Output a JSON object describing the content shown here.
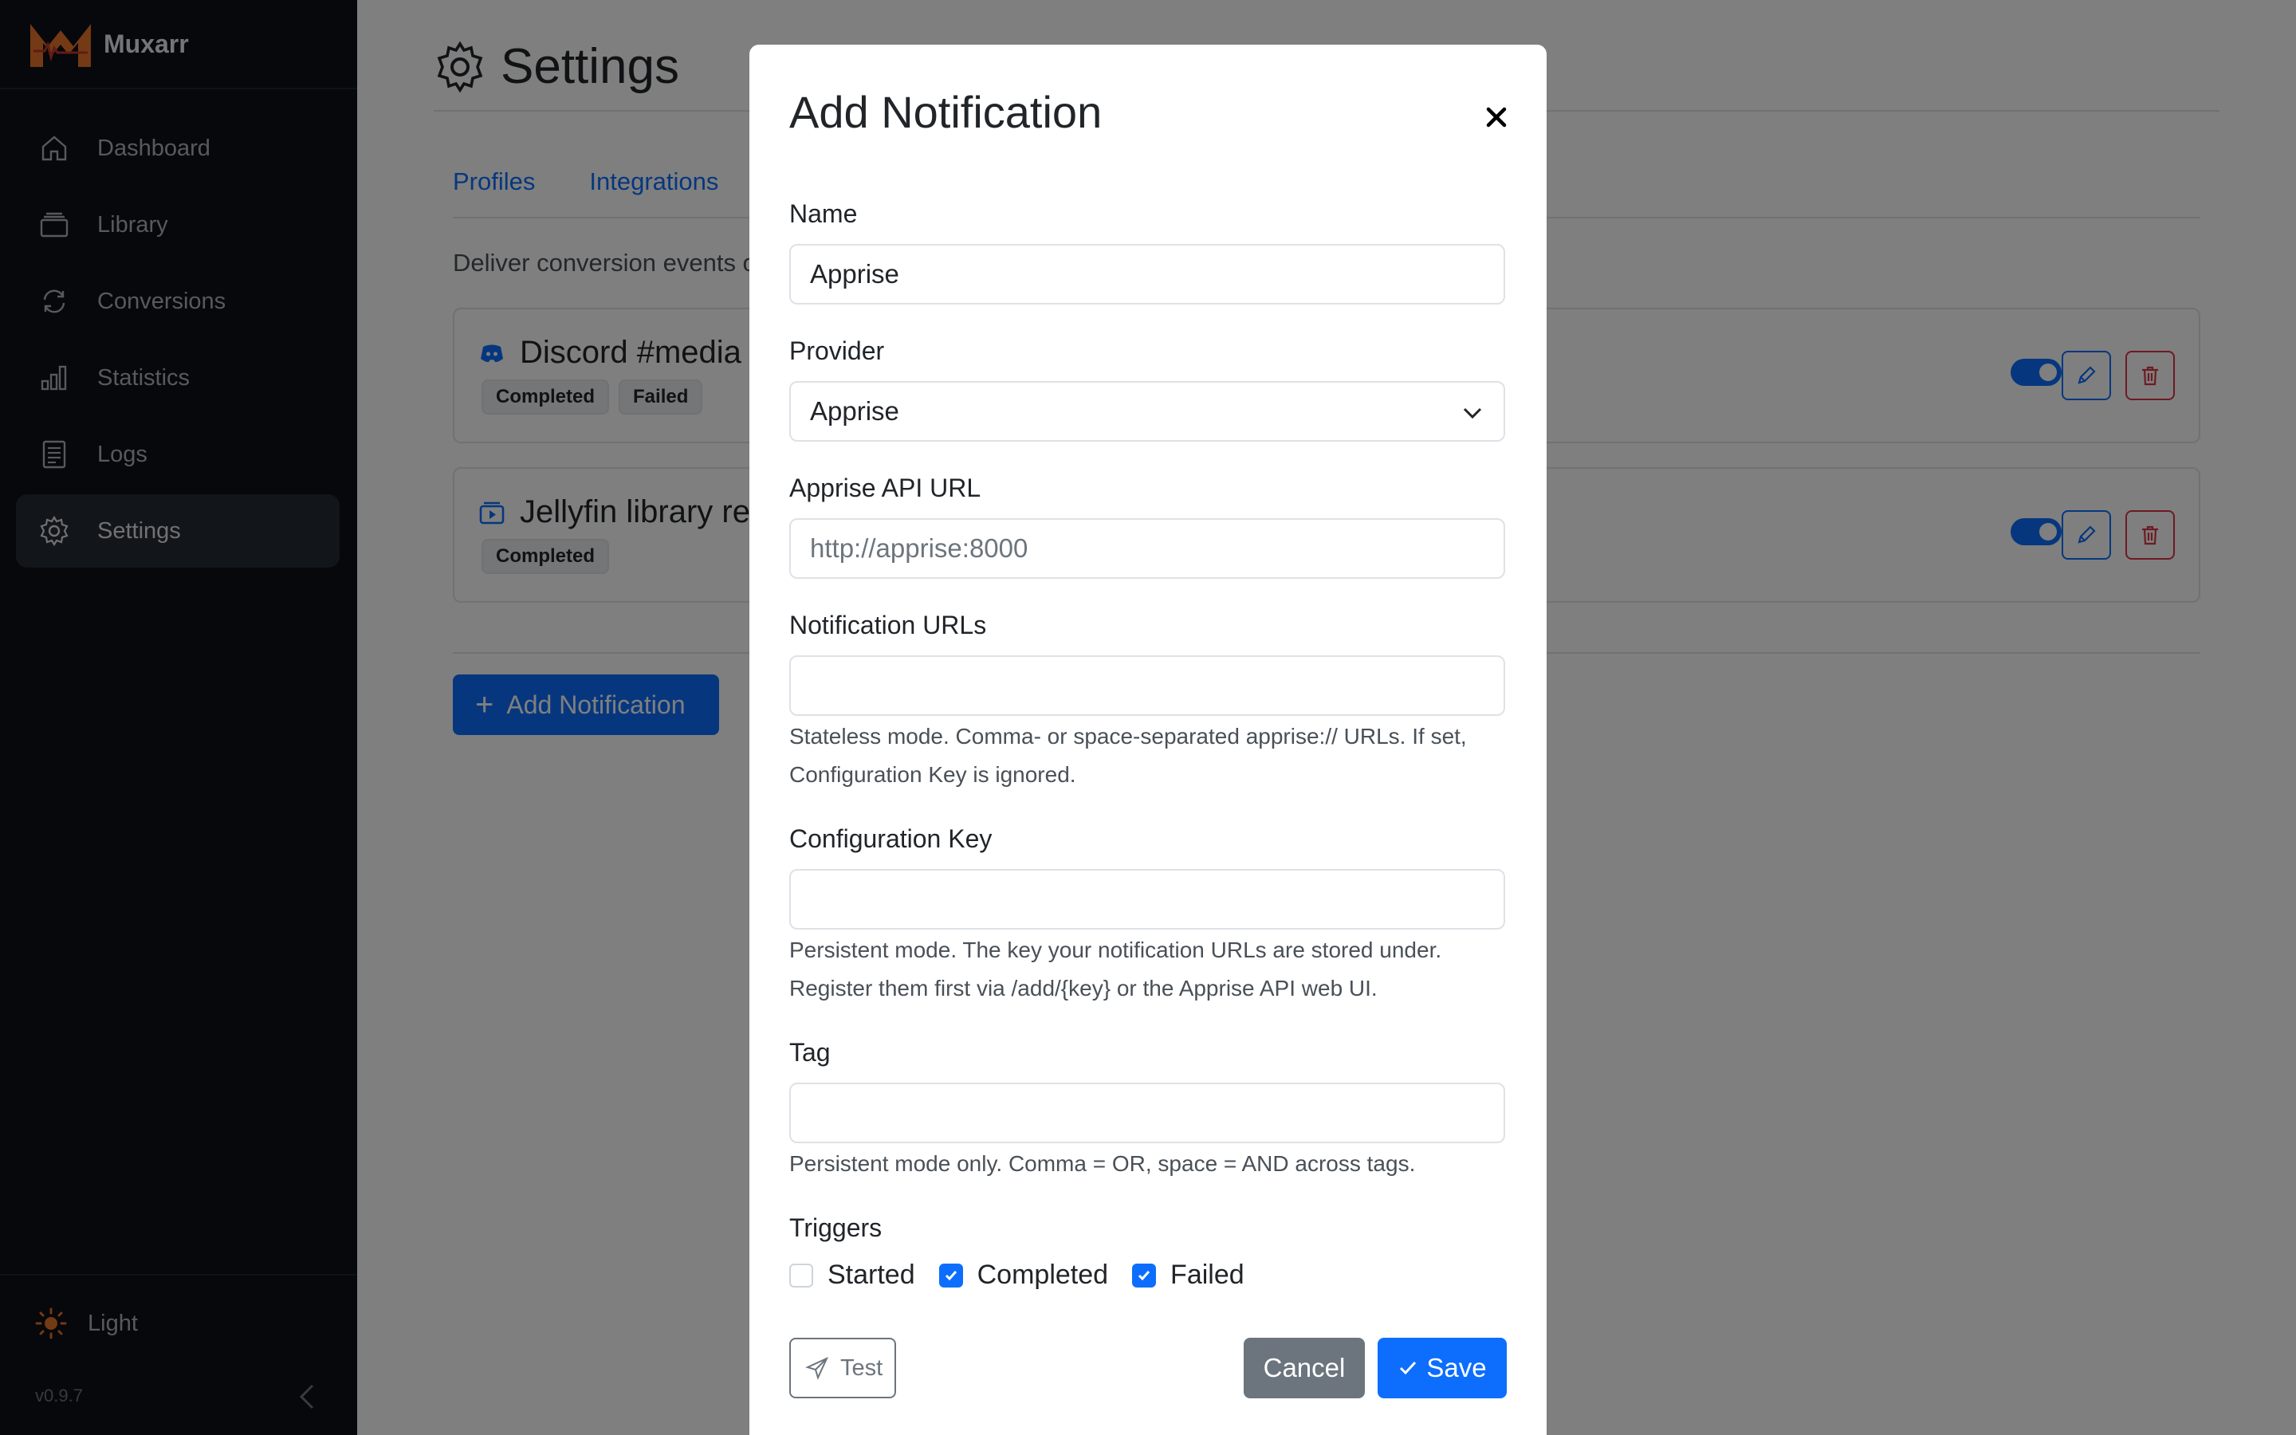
{
  "app": {
    "name": "Muxarr",
    "version": "v0.9.7",
    "theme_label": "Light",
    "accent_color": "#0d6efd",
    "danger_color": "#dc3545"
  },
  "sidebar": {
    "items": [
      {
        "label": "Dashboard",
        "icon": "home-icon"
      },
      {
        "label": "Library",
        "icon": "library-icon"
      },
      {
        "label": "Conversions",
        "icon": "sync-icon"
      },
      {
        "label": "Statistics",
        "icon": "bar-chart-icon"
      },
      {
        "label": "Logs",
        "icon": "log-icon"
      },
      {
        "label": "Settings",
        "icon": "gear-icon",
        "active": true
      }
    ]
  },
  "page": {
    "title": "Settings",
    "tabs": [
      "Profiles",
      "Integrations"
    ],
    "description": "Deliver conversion events oks to trigger other systems.",
    "notifications": [
      {
        "title": "Discord #media",
        "icon": "discord-icon",
        "badges": [
          "Completed",
          "Failed"
        ],
        "enabled": true
      },
      {
        "title": "Jellyfin library re",
        "icon": "jellyfin-icon",
        "badges": [
          "Completed"
        ],
        "enabled": true
      }
    ],
    "add_button_label": "Add Notification"
  },
  "modal": {
    "title": "Add Notification",
    "name_label": "Name",
    "name_value": "Apprise",
    "provider_label": "Provider",
    "provider_value": "Apprise",
    "api_url_label": "Apprise API URL",
    "api_url_placeholder": "http://apprise:8000",
    "notification_urls_label": "Notification URLs",
    "notification_urls_value": "",
    "notification_urls_help": "Stateless mode. Comma- or space-separated apprise:// URLs. If set, Configuration Key is ignored.",
    "config_key_label": "Configuration Key",
    "config_key_value": "",
    "config_key_help": "Persistent mode. The key your notification URLs are stored under. Register them first via /add/{key} or the Apprise API web UI.",
    "tag_label": "Tag",
    "tag_value": "",
    "tag_help": "Persistent mode only. Comma = OR, space = AND across tags.",
    "triggers_label": "Triggers",
    "triggers": [
      {
        "label": "Started",
        "checked": false
      },
      {
        "label": "Completed",
        "checked": true
      },
      {
        "label": "Failed",
        "checked": true
      }
    ],
    "test_label": "Test",
    "cancel_label": "Cancel",
    "save_label": "Save"
  }
}
